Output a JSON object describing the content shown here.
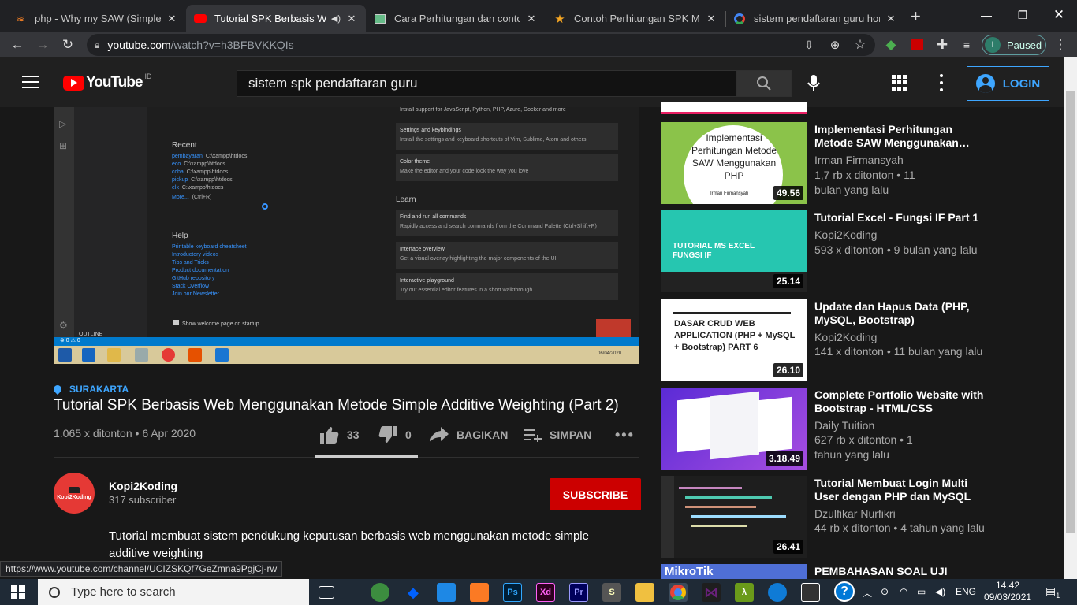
{
  "browser": {
    "tabs": [
      {
        "title": "php - Why my SAW (Simple Ad",
        "icon": "stackoverflow-icon"
      },
      {
        "title": "Tutorial SPK Berbasis Web",
        "icon": "youtube-icon",
        "active": true
      },
      {
        "title": "Cara Perhitungan dan contoh",
        "icon": "image-icon"
      },
      {
        "title": "Contoh Perhitungan SPK Meto",
        "icon": "star-icon"
      },
      {
        "title": "sistem pendaftaran guru hono",
        "icon": "google-icon"
      }
    ],
    "new_tab": "+",
    "url_host": "youtube.com",
    "url_path": "/watch?v=h3BFBVKKQIs",
    "profile_initial": "I",
    "profile_status": "Paused",
    "status_url": "https://www.youtube.com/channel/UCIZSKQf7GeZmna9PgjCj-rw"
  },
  "youtube": {
    "logo_text": "YouTube",
    "logo_region": "ID",
    "search_query": "sistem spk pendaftaran guru",
    "login_label": "LOGIN"
  },
  "player_screen": {
    "recent_heading": "Recent",
    "recent_items": [
      {
        "name": "pembayaran",
        "path": "C:\\xampp\\htdocs"
      },
      {
        "name": "eco",
        "path": "C:\\xampp\\htdocs"
      },
      {
        "name": "ccba",
        "path": "C:\\xampp\\htdocs"
      },
      {
        "name": "pickup",
        "path": "C:\\xampp\\htdocs"
      },
      {
        "name": "elk",
        "path": "C:\\xampp\\htdocs"
      }
    ],
    "more_label": "More...",
    "more_shortcut": "(Ctrl+R)",
    "help_heading": "Help",
    "help_items": [
      "Printable keyboard cheatsheet",
      "Introductory videos",
      "Tips and Tricks",
      "Product documentation",
      "GitHub repository",
      "Stack Overflow",
      "Join our Newsletter"
    ],
    "install_support": "Install support for JavaScript, Python, PHP, Azure, Docker and more",
    "cards": [
      {
        "title": "Settings and keybindings",
        "desc": "Install the settings and keyboard shortcuts of Vim, Sublime, Atom and others"
      },
      {
        "title": "Color theme",
        "desc": "Make the editor and your code look the way you love"
      }
    ],
    "learn_heading": "Learn",
    "learn_cards": [
      {
        "title": "Find and run all commands",
        "desc": "Rapidly access and search commands from the Command Palette (Ctrl+Shift+P)"
      },
      {
        "title": "Interface overview",
        "desc": "Get a visual overlay highlighting the major components of the UI"
      },
      {
        "title": "Interactive playground",
        "desc": "Try out essential editor features in a short walkthrough"
      }
    ],
    "outline_label": "OUTLINE",
    "show_welcome": "Show welcome page on startup",
    "status_left": "⊗ 0 ⚠ 0",
    "video_date": "06/04/2020"
  },
  "video": {
    "location": "SURAKARTA",
    "title": "Tutorial SPK Berbasis Web Menggunakan Metode Simple Additive Weighting (Part 2)",
    "views_date": "1.065 x ditonton • 6 Apr 2020",
    "likes": "33",
    "dislikes": "0",
    "share_label": "BAGIKAN",
    "save_label": "SIMPAN",
    "like_ratio": 1.0
  },
  "channel": {
    "name": "Kopi2Koding",
    "subs": "317 subscriber",
    "avatar_text": "Kopi2Koding",
    "subscribe_label": "SUBSCRIBE",
    "description": "Tutorial membuat sistem pendukung keputusan berbasis web menggunakan metode simple additive weighting"
  },
  "recommended": [
    {
      "title": "Implementasi Perhitungan Metode SAW Menggunakan…",
      "channel": "Irman Firmansyah",
      "meta": "1,7 rb x ditonton • 11 bulan yang lalu",
      "duration": "49.56",
      "thumb_text": "Implementasi Perhitungan Metode SAW Menggunakan PHP",
      "thumb_sub": "Irman Firmansyah"
    },
    {
      "title": "Tutorial Excel - Fungsi IF Part 1",
      "channel": "Kopi2Koding",
      "meta": "593 x ditonton • 9 bulan yang lalu",
      "duration": "25.14",
      "thumb_text": "TUTORIAL MS EXCEL FUNGSI IF"
    },
    {
      "title": "Update dan Hapus Data (PHP, MySQL, Bootstrap)",
      "channel": "Kopi2Koding",
      "meta": "141 x ditonton • 11 bulan yang lalu",
      "duration": "26.10",
      "thumb_text": "DASAR CRUD WEB APPLICATION (PHP + MySQL + Bootstrap) PART 6"
    },
    {
      "title": "Complete Portfolio Website with Bootstrap - HTML/CSS",
      "channel": "Daily Tuition",
      "meta": "627 rb x ditonton • 1 tahun yang lalu",
      "duration": "3.18.49"
    },
    {
      "title": "Tutorial Membuat Login Multi User dengan PHP dan MySQL",
      "channel": "Dzulfikar Nurfikri",
      "meta": "44 rb x ditonton • 4 tahun yang lalu",
      "duration": "26.41"
    },
    {
      "title": "PEMBAHASAN SOAL UJI",
      "thumb_text": "MikroTik"
    }
  ],
  "taskbar": {
    "search_placeholder": "Type here to search",
    "lang": "ENG",
    "time": "14.42",
    "date": "09/03/2021",
    "notif_count": "1"
  }
}
